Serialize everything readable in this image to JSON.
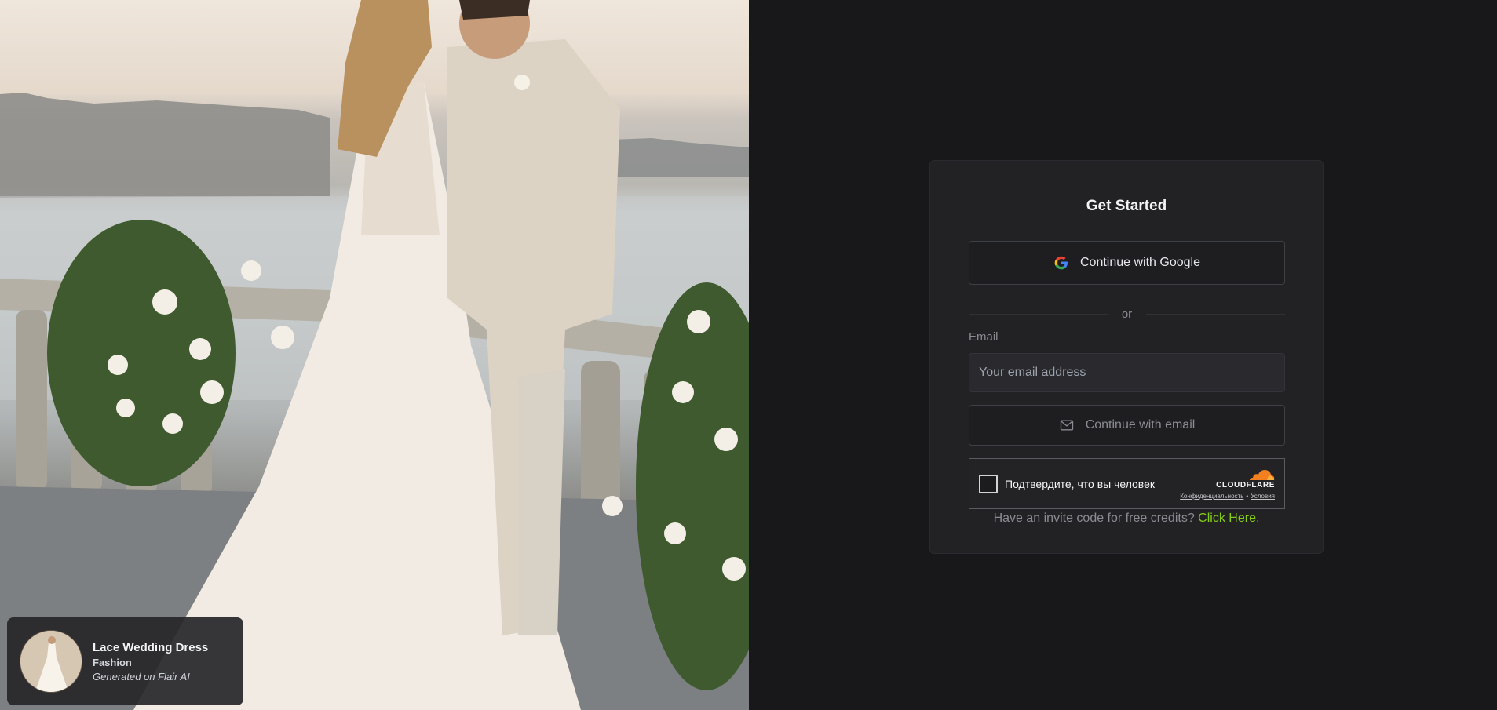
{
  "hero": {
    "image_description_icon": "wedding-photo",
    "credit": {
      "title": "Lace Wedding Dress",
      "category": "Fashion",
      "attribution": "Generated on Flair AI"
    }
  },
  "auth": {
    "title": "Get Started",
    "google_button_label": "Continue with Google",
    "divider_text": "or",
    "email_label": "Email",
    "email_placeholder": "Your email address",
    "email_value": "",
    "email_button_label": "Continue with email",
    "captcha": {
      "prompt": "Подтвердите, что вы человек",
      "brand": "CLOUDFLARE",
      "privacy_link": "Конфиденциальность",
      "separator": "•",
      "terms_link": "Условия"
    },
    "invite_prompt": "Have an invite code for free credits?",
    "invite_link": "Click Here",
    "invite_suffix": "."
  },
  "colors": {
    "page_background": "#18181b",
    "card_background": "#222225",
    "accent_link": "#84cc16",
    "cloudflare_orange": "#f38020"
  }
}
